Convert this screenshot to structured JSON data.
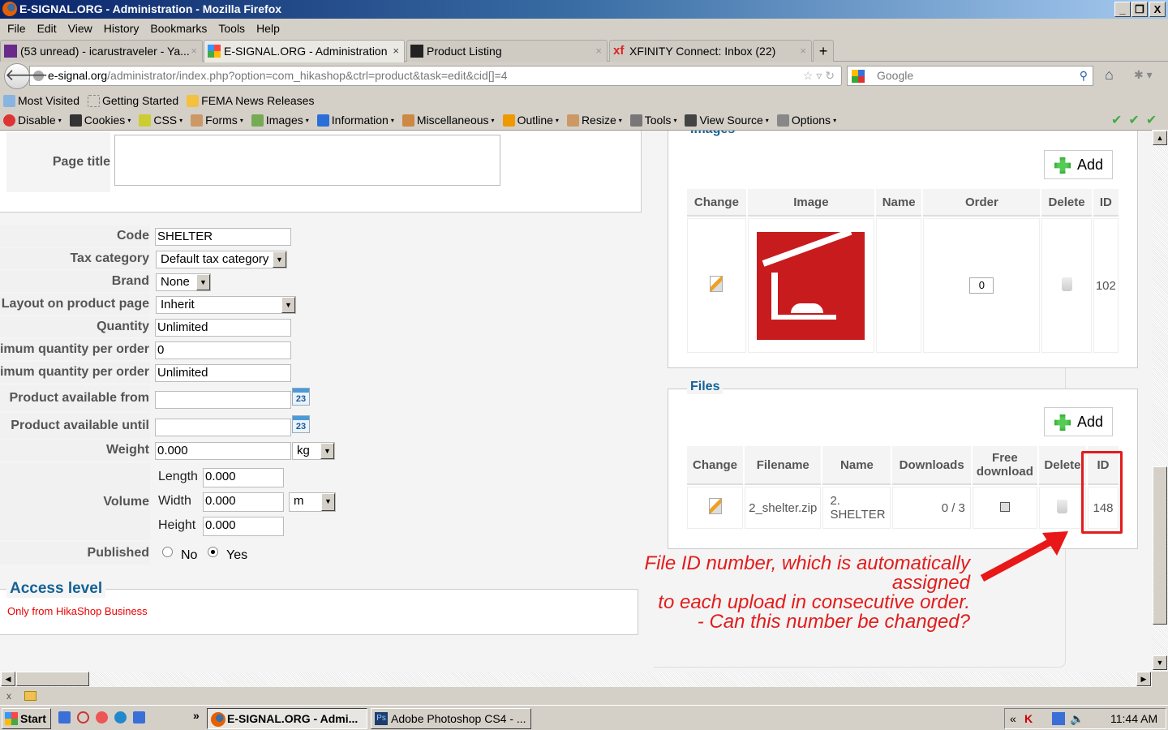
{
  "window": {
    "title": "E-SIGNAL.ORG - Administration - Mozilla Firefox",
    "min": "_",
    "restore": "❐",
    "close": "X"
  },
  "menu": [
    "File",
    "Edit",
    "View",
    "History",
    "Bookmarks",
    "Tools",
    "Help"
  ],
  "tabs": [
    {
      "label": "(53 unread) - icarustraveler - Ya...",
      "close": "×"
    },
    {
      "label": "E-SIGNAL.ORG - Administration",
      "close": "×"
    },
    {
      "label": "Product Listing",
      "close": "×"
    },
    {
      "label": "XFINITY Connect: Inbox (22)",
      "close": "×"
    }
  ],
  "new_tab": "+",
  "url": {
    "domain": "e-signal.org",
    "path": "/administrator/index.php?option=com_hikashop&ctrl=product&task=edit&cid[]=4"
  },
  "search_placeholder": "Google",
  "bookmarks": [
    "Most Visited",
    "Getting Started",
    "FEMA News Releases"
  ],
  "webdev": [
    "Disable",
    "Cookies",
    "CSS",
    "Forms",
    "Images",
    "Information",
    "Miscellaneous",
    "Outline",
    "Resize",
    "Tools",
    "View Source",
    "Options"
  ],
  "form": {
    "page_title_label": "Page title",
    "code_label": "Code",
    "code": "SHELTER",
    "tax_label": "Tax category",
    "tax": "Default tax category",
    "brand_label": "Brand",
    "brand": "None",
    "layout_label": "Layout on product page",
    "layout": "Inherit",
    "quantity_label": "Quantity",
    "quantity": "Unlimited",
    "min_label": "Minimum quantity per order",
    "min": "0",
    "max_label": "Maximum quantity per order",
    "max": "Unlimited",
    "from_label": "Product available from",
    "until_label": "Product available until",
    "cal": "23",
    "weight_label": "Weight",
    "weight": "0.000",
    "weight_unit": "kg",
    "volume_label": "Volume",
    "length_label": "Length",
    "length": "0.000",
    "width_label": "Width",
    "width": "0.000",
    "height_label": "Height",
    "height": "0.000",
    "volume_unit": "m",
    "published_label": "Published",
    "no": "No",
    "yes": "Yes",
    "published": "Yes",
    "access_legend": "Access level",
    "access_text": "Only from HikaShop Business"
  },
  "images": {
    "legend": "Images",
    "add": "Add",
    "headers": [
      "Change",
      "Image",
      "Name",
      "Order",
      "Delete",
      "ID"
    ],
    "row": {
      "name": "",
      "order": "0",
      "id": "102"
    }
  },
  "files": {
    "legend": "Files",
    "add": "Add",
    "headers": [
      "Change",
      "Filename",
      "Name",
      "Downloads",
      "Free download",
      "Delete",
      "ID"
    ],
    "row": {
      "filename": "2_shelter.zip",
      "name": "2. SHELTER",
      "downloads": "0 / 3",
      "free": false,
      "id": "148"
    }
  },
  "annotation": [
    "File ID number, which is automatically assigned",
    "to each upload in consecutive order.",
    "- Can this number be changed?"
  ],
  "annotation_color": "#e21c1c",
  "taskbar": {
    "start": "Start",
    "tasks": [
      "E-SIGNAL.ORG - Admi...",
      "Adobe Photoshop CS4 - ..."
    ],
    "clock": "11:44 AM",
    "chevron": "»",
    "tray_chevron": "«"
  },
  "statusbar": {
    "close": "x"
  }
}
